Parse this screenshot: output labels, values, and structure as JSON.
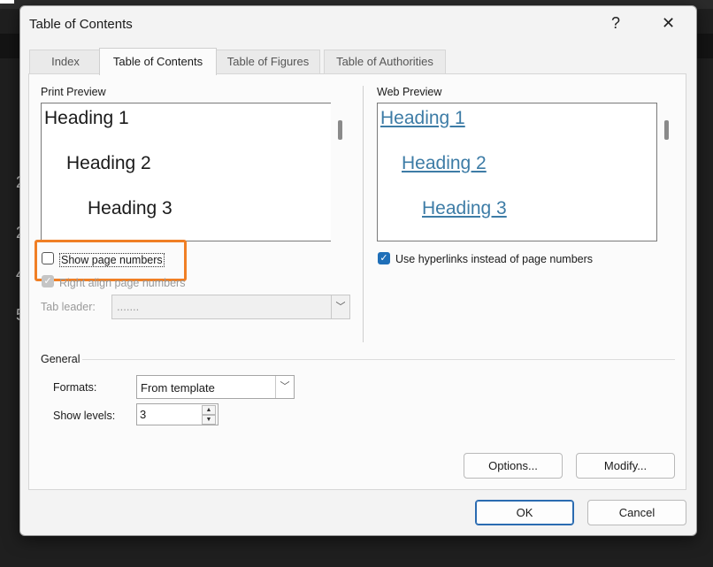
{
  "background": {
    "ruler_numbers": [
      "2",
      "2",
      "4",
      "5"
    ]
  },
  "dialog": {
    "title": "Table of Contents",
    "help_label": "?",
    "close_label": "✕"
  },
  "tabs": [
    {
      "label": "Index",
      "active": false
    },
    {
      "label": "Table of Contents",
      "active": true
    },
    {
      "label": "Table of Figures",
      "active": false
    },
    {
      "label": "Table of Authorities",
      "active": false
    }
  ],
  "print_preview": {
    "label": "Print Preview",
    "headings": [
      "Heading 1",
      "Heading 2",
      "Heading 3"
    ],
    "show_page_numbers": {
      "label": "Show page numbers",
      "checked": false
    },
    "right_align": {
      "label": "Right align page numbers",
      "checked": true,
      "disabled": true
    },
    "tab_leader": {
      "label": "Tab leader:",
      "value": "......."
    }
  },
  "web_preview": {
    "label": "Web Preview",
    "headings": [
      "Heading 1",
      "Heading 2",
      "Heading 3"
    ],
    "use_hyperlinks": {
      "label": "Use hyperlinks instead of page numbers",
      "checked": true
    }
  },
  "general": {
    "label": "General",
    "formats": {
      "label": "Formats:",
      "value": "From template"
    },
    "show_levels": {
      "label": "Show levels:",
      "value": "3"
    }
  },
  "buttons": {
    "options": "Options...",
    "modify": "Modify...",
    "ok": "OK",
    "cancel": "Cancel"
  },
  "colors": {
    "accent": "#1f6fb8",
    "highlight": "#f07f25",
    "link": "#3d7ca6"
  }
}
